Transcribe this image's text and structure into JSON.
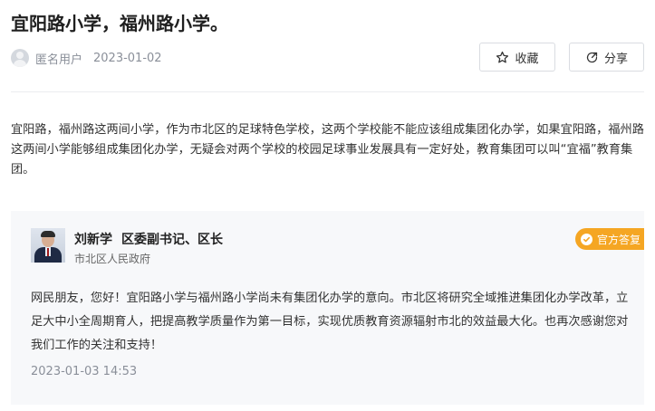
{
  "post": {
    "title": "宜阳路小学，福州路小学。",
    "author": "匿名用户",
    "date": "2023-01-02",
    "actions": {
      "favorite_label": "收藏",
      "share_label": "分享"
    },
    "content": "宜阳路，福州路这两间小学，作为市北区的足球特色学校，这两个学校能不能应该组成集团化办学，如果宜阳路，福州路这两间小学能够组成集团化办学，无疑会对两个学校的校园足球事业发展具有一定好处，教育集团可以叫“宜福”教育集团。"
  },
  "reply": {
    "name": "刘新学",
    "position": "区委副书记、区长",
    "org": "市北区人民政府",
    "badge": "官方答复",
    "badge_color": "#f5a623",
    "content": "网民朋友，您好！宜阳路小学与福州路小学尚未有集团化办学的意向。市北区将研究全域推进集团化办学改革，立足大中小全周期育人，把提高教学质量作为第一目标，实现优质教育资源辐射市北的效益最大化。也再次感谢您对我们工作的关注和支持！",
    "time": "2023-01-03 14:53"
  }
}
